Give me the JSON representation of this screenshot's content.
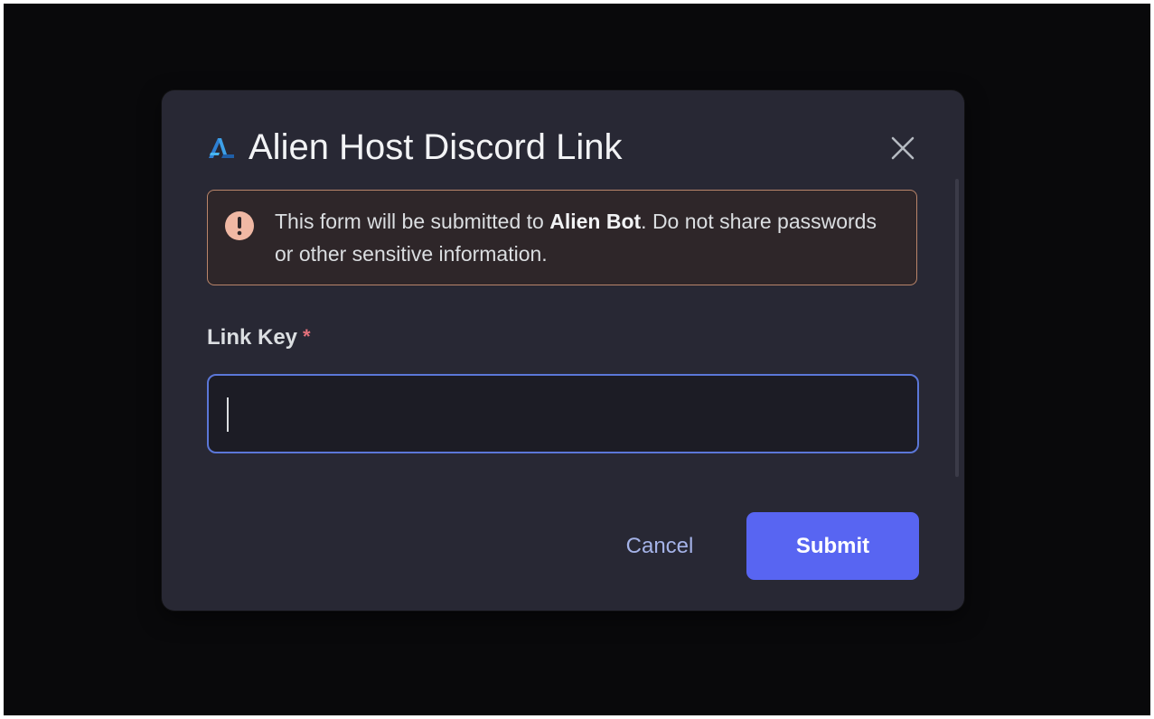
{
  "dialog": {
    "title": "Alien Host Discord Link",
    "close_icon": "close-icon",
    "app_icon": "alien-host-logo-icon"
  },
  "warning": {
    "icon": "exclamation-circle-icon",
    "text_before": "This form will be submitted to ",
    "bot_name": "Alien Bot",
    "text_after": ". Do not share passwords or other sensitive information.",
    "accent_color": "#b9856a"
  },
  "form": {
    "field_label": "Link Key",
    "required_marker": "*",
    "input_value": "",
    "input_border_color": "#5b77d8"
  },
  "actions": {
    "cancel_label": "Cancel",
    "submit_label": "Submit",
    "submit_color": "#5865f2"
  }
}
